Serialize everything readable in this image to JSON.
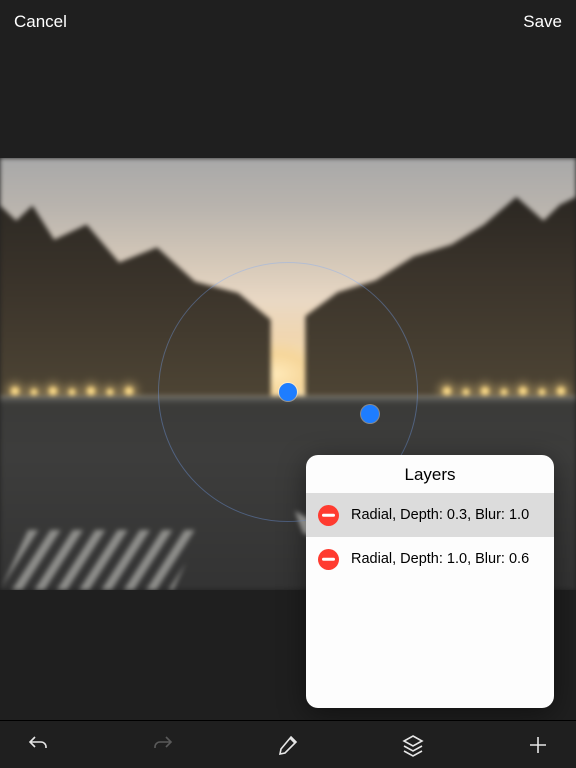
{
  "header": {
    "cancel": "Cancel",
    "save": "Save"
  },
  "popover": {
    "title": "Layers",
    "items": [
      {
        "label": "Radial, Depth: 0.3, Blur: 1.0",
        "selected": true
      },
      {
        "label": "Radial, Depth: 1.0, Blur: 0.6",
        "selected": false
      }
    ]
  },
  "toolbar": {
    "undo": "undo",
    "redo": "redo",
    "brush": "brush",
    "layers": "layers",
    "add": "add"
  },
  "colors": {
    "accent": "#1e7dff",
    "destructive": "#ff3b30",
    "bg": "#1f1f1f"
  }
}
